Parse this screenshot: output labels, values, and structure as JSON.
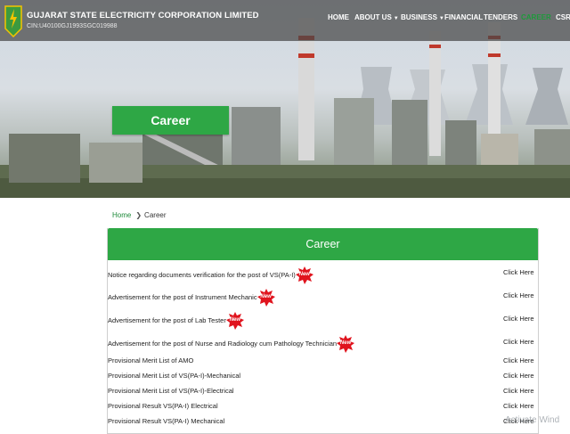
{
  "header": {
    "company_name": "GUJARAT STATE ELECTRICITY CORPORATION LIMITED",
    "cin": "CIN:U40100GJ1993SGC019988",
    "logo_text": "GSECL",
    "nav": [
      {
        "label": "HOME",
        "dropdown": false,
        "active": false
      },
      {
        "label": "ABOUT US",
        "dropdown": true,
        "active": false
      },
      {
        "label": "BUSINESS",
        "dropdown": true,
        "active": false
      },
      {
        "label": "FINANCIAL",
        "dropdown": false,
        "active": false
      },
      {
        "label": "TENDERS",
        "dropdown": false,
        "active": false
      },
      {
        "label": "CAREER",
        "dropdown": false,
        "active": true
      },
      {
        "label": "CSR",
        "dropdown": false,
        "active": false
      }
    ]
  },
  "hero": {
    "banner_title": "Career"
  },
  "breadcrumb": {
    "home": "Home",
    "separator": "❯",
    "current": "Career"
  },
  "panel": {
    "title": "Career",
    "link_label": "Click Here",
    "badge_label": "New",
    "rows": [
      {
        "title": "Notice regarding documents verification for the post of VS(PA-I)",
        "is_new": true
      },
      {
        "title": "Advertisement for the post of Instrument Mechanic",
        "is_new": true
      },
      {
        "title": "Advertisement for the post of Lab Tester",
        "is_new": true
      },
      {
        "title": "Advertisement for the post of Nurse and Radiology cum Pathology Technician",
        "is_new": true
      },
      {
        "title": "Provisional Merit List of AMO",
        "is_new": false
      },
      {
        "title": "Provisional Merit List of VS(PA-I)-Mechanical",
        "is_new": false
      },
      {
        "title": "Provisional Merit List of VS(PA-I)-Electrical",
        "is_new": false
      },
      {
        "title": "Provisional Result VS(PA-I) Electrical",
        "is_new": false
      },
      {
        "title": "Provisional Result VS(PA-I) Mechanical",
        "is_new": false
      }
    ]
  },
  "watermark": "Activate Wind",
  "colors": {
    "accent_green": "#2ea745",
    "active_nav": "#1e9a3b",
    "badge_red": "#e0141e"
  }
}
